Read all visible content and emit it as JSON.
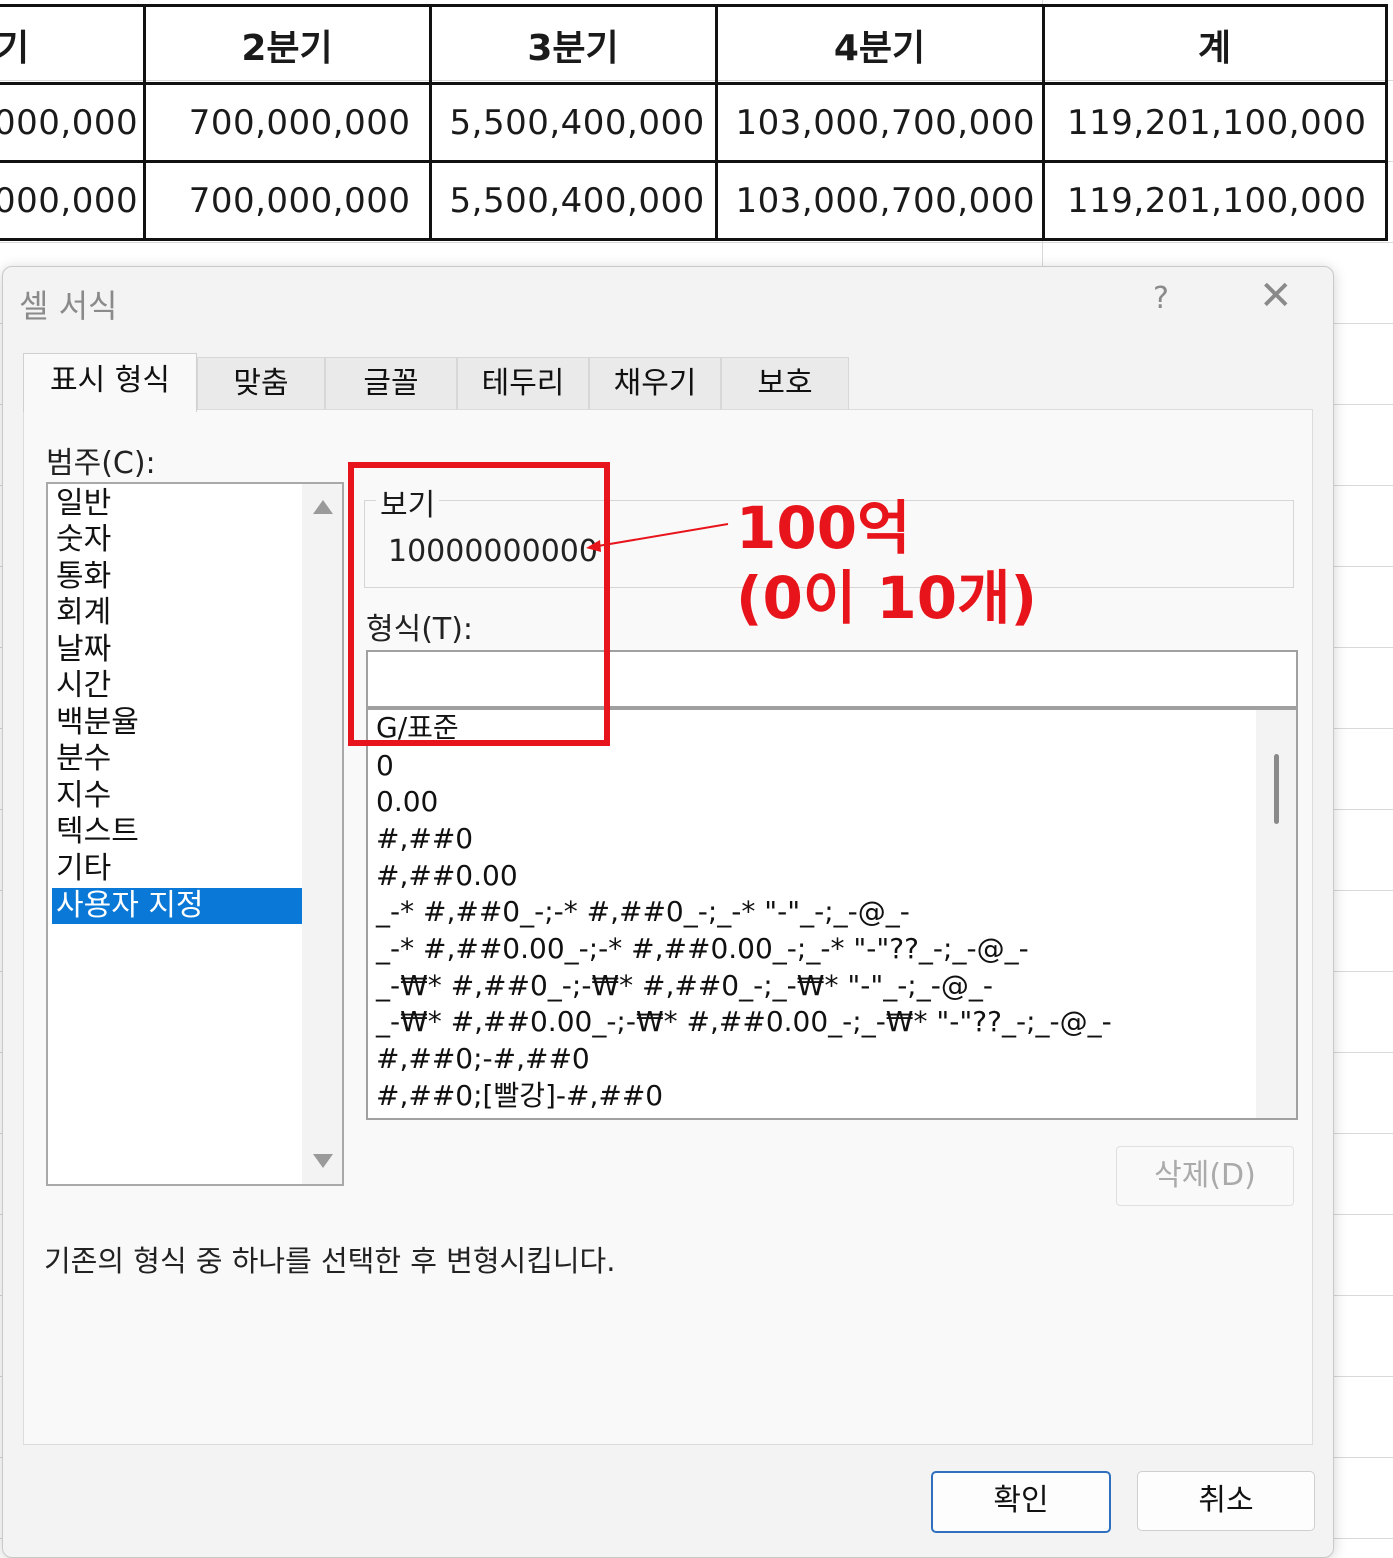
{
  "table": {
    "headers": [
      "기",
      "2분기",
      "3분기",
      "4분기",
      "계"
    ],
    "rows": [
      [
        "000,000",
        "700,000,000",
        "5,500,400,000",
        "103,000,700,000",
        "119,201,100,000"
      ],
      [
        "000,000",
        "700,000,000",
        "5,500,400,000",
        "103,000,700,000",
        "119,201,100,000"
      ]
    ]
  },
  "dialog": {
    "title": "셀 서식",
    "help": "?",
    "close": "✕",
    "tabs": [
      "표시 형식",
      "맞춤",
      "글꼴",
      "테두리",
      "채우기",
      "보호"
    ],
    "category_label": "범주(C):",
    "categories": [
      "일반",
      "숫자",
      "통화",
      "회계",
      "날짜",
      "시간",
      "백분율",
      "분수",
      "지수",
      "텍스트",
      "기타",
      "사용자 지정"
    ],
    "selected_category": "사용자 지정",
    "preview_label": "보기",
    "preview_value": "10000000000",
    "format_label": "형식(T):",
    "format_value": "",
    "formats": [
      "G/표준",
      "0",
      "0.00",
      "#,##0",
      "#,##0.00",
      "_-* #,##0_-;-* #,##0_-;_-* \"-\"_-;_-@_-",
      "_-* #,##0.00_-;-* #,##0.00_-;_-* \"-\"??_-;_-@_-",
      "_-₩* #,##0_-;-₩* #,##0_-;_-₩* \"-\"_-;_-@_-",
      "_-₩* #,##0.00_-;-₩* #,##0.00_-;_-₩* \"-\"??_-;_-@_-",
      "#,##0;-#,##0",
      "#,##0;[빨강]-#,##0"
    ],
    "delete_label": "삭제(D)",
    "description": "기존의 형식 중 하나를 선택한 후 변형시킵니다.",
    "ok_label": "확인",
    "cancel_label": "취소"
  },
  "annotation": {
    "line1": "100억",
    "line2": "(0이 10개)",
    "color": "#e8141b"
  },
  "colors": {
    "selection": "#0a78d7",
    "ok_border": "#2f6fbd"
  }
}
